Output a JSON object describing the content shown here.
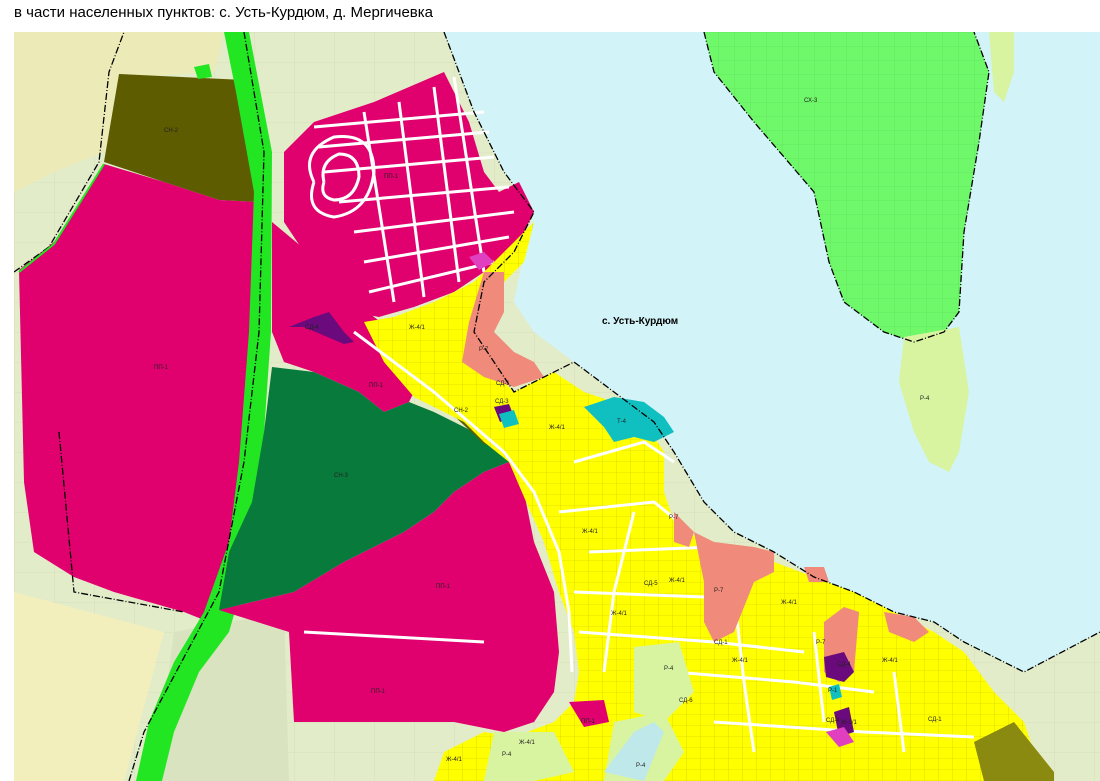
{
  "caption": "в части населенных пунктов: с. Усть-Курдюм, д. Мергичевка",
  "map": {
    "place_label": "с. Усть-Курдюм",
    "colors": {
      "water": "#d2f4f8",
      "residential": "#ffff00",
      "industrial": "#e0006e",
      "agricultural_dark": "#5e5c00",
      "agricultural_green": "#087a3c",
      "agricultural_light": "#78f86a",
      "road": "#22e622",
      "recreation": "#f08a7a",
      "transport": "#10c0c0",
      "public": "#6a0a7c",
      "recreation_light": "#d8f4a0",
      "background": "#e3ecc9"
    },
    "zone_labels": {
      "sh2_a": "СН-2",
      "sh2_b": "СН-2",
      "sh3": "СН-3",
      "shx3": "СХ-3",
      "pp1_a": "ПП-1",
      "pp1_b": "ПП-1",
      "pp1_c": "ПП-1",
      "pp1_d": "ПП-1",
      "pp1_e": "ПП-1",
      "pp1_f": "ПП-1",
      "zh41_a": "Ж-4/1",
      "zh41_b": "Ж-4/1",
      "zh41_c": "Ж-4/1",
      "zh41_d": "Ж-4/1",
      "zh41_e": "Ж-4/1",
      "zh41_f": "Ж-4/1",
      "zh41_g": "Ж-4/1",
      "zh41_h": "Ж-4/1",
      "zh41_i": "Ж-4/1",
      "zh41_j": "Ж-4/1",
      "r7_a": "Р-7",
      "r7_b": "Р-7",
      "r7_c": "Р-7",
      "r7_d": "Р-7",
      "r4_a": "Р-4",
      "r4_b": "Р-4",
      "r4_c": "Р-4",
      "r4_d": "Р-4",
      "t4": "Т-4",
      "sd4_a": "СД-4",
      "sd4_b": "СД-4",
      "sd4_c": "СД-4",
      "sd1_a": "СД-1",
      "sd1_b": "СД-1",
      "sd1_c": "СД-1",
      "sd3": "СД-3",
      "sd5": "СД-5",
      "sd6": "СД-6",
      "r1": "Р-1",
      "zh21": "Ж-2/1"
    }
  }
}
